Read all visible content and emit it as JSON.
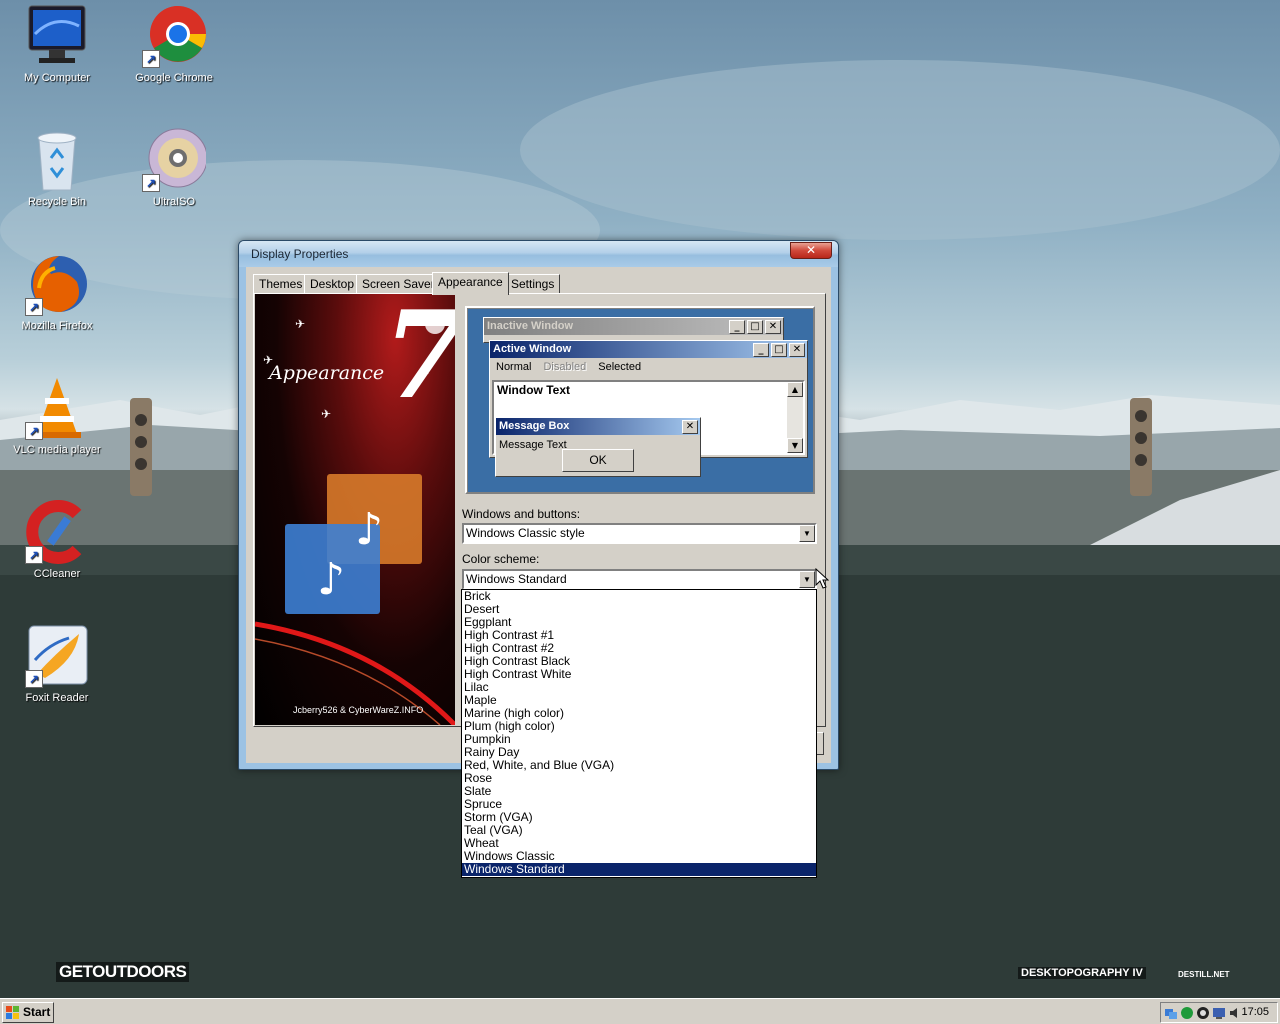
{
  "desktop": {
    "icons": [
      {
        "label": "My Computer",
        "icon": "computer-icon"
      },
      {
        "label": "Google Chrome",
        "icon": "chrome-icon"
      },
      {
        "label": "Recycle Bin",
        "icon": "recycle-bin-icon"
      },
      {
        "label": "UltraISO",
        "icon": "ultraiso-icon"
      },
      {
        "label": "Mozilla Firefox",
        "icon": "firefox-icon"
      },
      {
        "label": "VLC media player",
        "icon": "vlc-icon"
      },
      {
        "label": "CCleaner",
        "icon": "ccleaner-icon"
      },
      {
        "label": "Foxit Reader",
        "icon": "foxit-reader-icon"
      }
    ],
    "wallpaper_text": {
      "left_logo": "GETOUTDOORS",
      "right_logo": "DESKTOPOGRAPHY IV",
      "right_logo2": "DESTILL.NET"
    }
  },
  "dialog": {
    "title": "Display Properties",
    "close_glyph": "✕",
    "tabs": [
      "Themes",
      "Desktop",
      "Screen Saver",
      "Appearance",
      "Settings"
    ],
    "selected_tab": "Appearance",
    "side_image": {
      "title": "Appearance",
      "number": "7",
      "credit": "Jcberry526 & CyberWareZ.INFO"
    },
    "preview": {
      "inactive_title": "Inactive Window",
      "active_title": "Active Window",
      "menu": [
        "Normal",
        "Disabled",
        "Selected"
      ],
      "window_text": "Window Text",
      "message_box_title": "Message Box",
      "message_text": "Message Text",
      "ok_label": "OK"
    },
    "windows_and_buttons_label": "Windows and buttons:",
    "windows_and_buttons_value": "Windows Classic style",
    "color_scheme_label": "Color scheme:",
    "color_scheme_value": "Windows Standard",
    "color_scheme_options": [
      "Brick",
      "Desert",
      "Eggplant",
      "High Contrast #1",
      "High Contrast #2",
      "High Contrast Black",
      "High Contrast White",
      "Lilac",
      "Maple",
      "Marine (high color)",
      "Plum (high color)",
      "Pumpkin",
      "Rainy Day",
      "Red, White, and Blue (VGA)",
      "Rose",
      "Slate",
      "Spruce",
      "Storm (VGA)",
      "Teal (VGA)",
      "Wheat",
      "Windows Classic",
      "Windows Standard"
    ],
    "selected_option_index": 21
  },
  "taskbar": {
    "start_label": "Start",
    "clock": "17:05"
  },
  "colors": {
    "selection": "#0a246a",
    "dialog_face": "#d4d0c8",
    "preview_desktop": "#3a6ea5"
  }
}
